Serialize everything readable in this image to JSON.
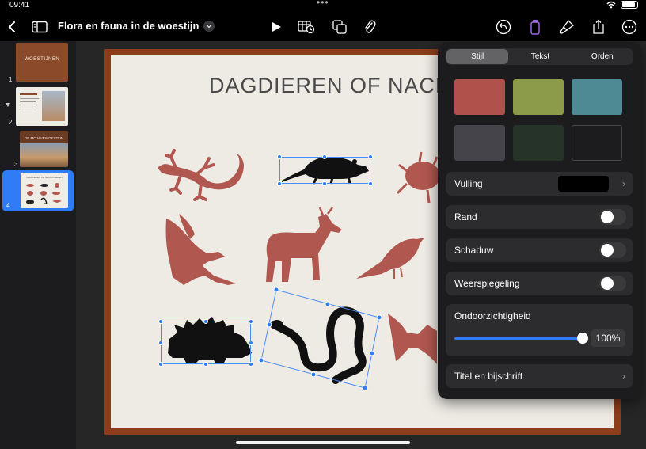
{
  "status_bar": {
    "time": "09:41"
  },
  "toolbar": {
    "doc_title": "Flora en fauna in de woestijn"
  },
  "navigator": {
    "slides": [
      {
        "number": "1",
        "title": "WOESTIJNEN"
      },
      {
        "number": "2",
        "title": ""
      },
      {
        "number": "3",
        "title": "DE MOJAVEWOESTIJN"
      },
      {
        "number": "4",
        "title": "DAGDIEREN OF NACHTDIEREN"
      }
    ],
    "selected": "4"
  },
  "slide": {
    "title": "DAGDIEREN OF NACHTDIEREN"
  },
  "format_panel": {
    "tabs": [
      "Stijl",
      "Tekst",
      "Orden"
    ],
    "active_tab": "Stijl",
    "style_swatches": [
      "#b1514c",
      "#8b9b4a",
      "#4d8a93",
      "#45444a",
      "#263328",
      "#1c1c1e"
    ],
    "fill_label": "Vulling",
    "fill_color": "#000000",
    "border_label": "Rand",
    "shadow_label": "Schaduw",
    "reflection_label": "Weerspiegeling",
    "opacity_label": "Ondoorzichtigheid",
    "opacity_value": "100%",
    "opacity_fraction": 1.0,
    "caption_label": "Titel en bijschrift"
  },
  "colors": {
    "accent": "#2f7cf6",
    "animal": "#b0574f",
    "selected_shape": "#111111"
  }
}
